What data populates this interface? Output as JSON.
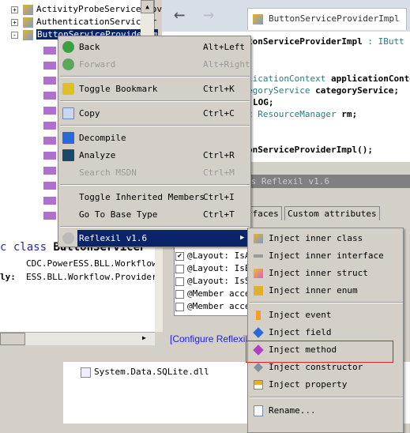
{
  "tree": {
    "items": [
      {
        "label": "ActivityProbeServiceProv",
        "expander": "+"
      },
      {
        "label": "AuthenticationServicePr",
        "expander": "+"
      },
      {
        "label": "ButtonServiceProviderIm",
        "expander": "-",
        "selected": true
      }
    ]
  },
  "editor": {
    "tab_title": "ButtonServiceProviderImpl",
    "code": [
      {
        "a": "tonServiceProviderImpl",
        "b": " : IButt"
      },
      {
        "a": "licationContext ",
        "b": "applicationConte"
      },
      {
        "a": "egoryService ",
        "b": "categoryService;"
      },
      {
        "a": "",
        "b": "LOG;"
      },
      {
        "a": "c ResourceManager ",
        "b": "rm;"
      },
      {
        "a": "",
        "b": "onServiceProviderImpl();"
      }
    ]
  },
  "reflexil": {
    "title": "'s Reflexil v1.6",
    "tabs": [
      "rfaces",
      "Custom attributes"
    ],
    "checks": [
      {
        "label": "@Layout: IsA",
        "checked": true
      },
      {
        "label": "@Layout: IsE",
        "checked": false
      },
      {
        "label": "@Layout: IsS",
        "checked": false
      },
      {
        "label": "@Member acce",
        "checked": false
      },
      {
        "label": "@Member acce",
        "checked": false
      }
    ],
    "configure_link": "[Configure Reflexil ..."
  },
  "lower": {
    "class_line_a": "c class ",
    "class_line_b": "ButtonServiceP",
    "namespace": "CDC.PowerESS.BLL.Workflow.",
    "assembly_label": "ly:",
    "assembly": "ESS.BLL.Workflow.Provider,"
  },
  "bottom": {
    "file": "System.Data.SQLite.dll"
  },
  "context_menu": {
    "items": [
      {
        "label": "Back",
        "shortcut": "Alt+Left",
        "icon": "back-arrow-icon",
        "disabled": false
      },
      {
        "label": "Forward",
        "shortcut": "Alt+Right",
        "icon": "forward-arrow-icon",
        "disabled": true
      },
      {
        "label": "Toggle Bookmark",
        "shortcut": "Ctrl+K",
        "icon": "bookmark-icon",
        "disabled": false
      },
      {
        "label": "Copy",
        "shortcut": "Ctrl+C",
        "icon": "copy-icon",
        "disabled": false
      },
      {
        "label": "Decompile",
        "shortcut": "",
        "icon": "decompile-icon",
        "disabled": false
      },
      {
        "label": "Analyze",
        "shortcut": "Ctrl+R",
        "icon": "analyze-icon",
        "disabled": false
      },
      {
        "label": "Search MSDN",
        "shortcut": "Ctrl+M",
        "icon": "",
        "disabled": true
      },
      {
        "label": "Toggle Inherited Members",
        "shortcut": "Ctrl+I",
        "icon": "",
        "disabled": false
      },
      {
        "label": "Go To Base Type",
        "shortcut": "Ctrl+T",
        "icon": "",
        "disabled": false
      },
      {
        "label": "Reflexil v1.6",
        "shortcut": "",
        "icon": "reflexil-icon",
        "submenu": true
      }
    ]
  },
  "submenu": {
    "items": [
      {
        "label": "Inject inner class",
        "icon": "class-icon"
      },
      {
        "label": "Inject inner interface",
        "icon": "interface-icon"
      },
      {
        "label": "Inject inner struct",
        "icon": "struct-icon"
      },
      {
        "label": "Inject inner enum",
        "icon": "enum-icon"
      },
      {
        "label": "Inject event",
        "icon": "event-icon"
      },
      {
        "label": "Inject field",
        "icon": "field-icon"
      },
      {
        "label": "Inject method",
        "icon": "method-icon",
        "highlighted_box": true
      },
      {
        "label": "Inject constructor",
        "icon": "constructor-icon"
      },
      {
        "label": "Inject property",
        "icon": "property-icon"
      },
      {
        "label": "Rename...",
        "icon": "rename-icon"
      }
    ]
  },
  "colors": {
    "selection": "#0a246a",
    "highlight_box": "#e02020",
    "link": "#1a1aff"
  }
}
